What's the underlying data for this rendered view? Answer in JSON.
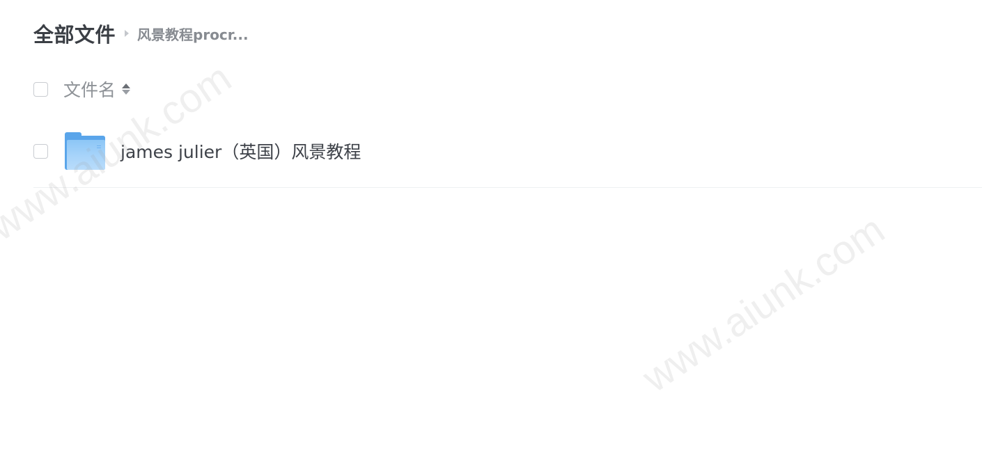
{
  "breadcrumb": {
    "root": "全部文件",
    "current": "风景教程procr..."
  },
  "list_header": {
    "column_label": "文件名"
  },
  "files": [
    {
      "name": "james julier（英国）风景教程",
      "type": "folder"
    }
  ],
  "watermark": {
    "text": "www.aiunk.com"
  },
  "icons": {
    "separator": "chevron-right-icon",
    "sort": "sort-icon",
    "folder": "folder-icon"
  },
  "colors": {
    "folder": "#5aa5ea",
    "text_primary": "#3d4148",
    "text_secondary": "#8e9297"
  }
}
